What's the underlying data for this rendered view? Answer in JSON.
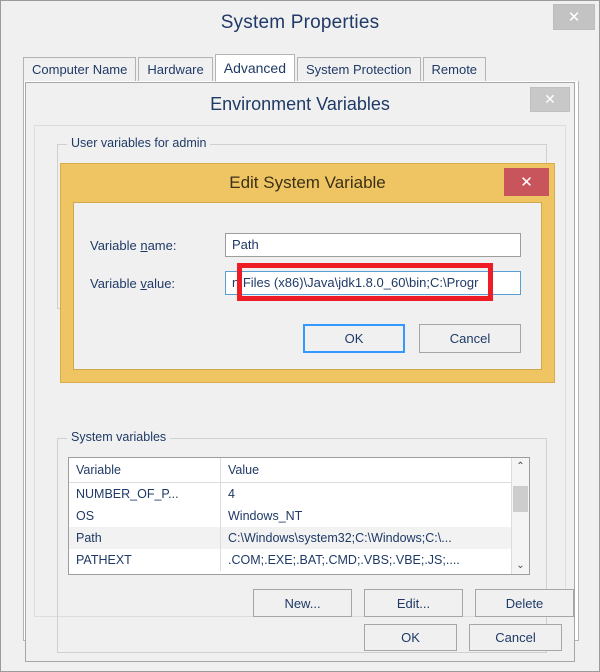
{
  "window": {
    "title": "System Properties",
    "close_label": "✕"
  },
  "tabs": [
    {
      "label": "Computer Name",
      "active": false
    },
    {
      "label": "Hardware",
      "active": false
    },
    {
      "label": "Advanced",
      "active": true
    },
    {
      "label": "System Protection",
      "active": false
    },
    {
      "label": "Remote",
      "active": false
    }
  ],
  "env_dialog": {
    "title": "Environment Variables",
    "close_label": "✕",
    "user_group_legend": "User variables for admin",
    "system_group_legend": "System variables",
    "table": {
      "headers": [
        "Variable",
        "Value"
      ],
      "rows": [
        {
          "variable": "NUMBER_OF_P...",
          "value": "4",
          "selected": false
        },
        {
          "variable": "OS",
          "value": "Windows_NT",
          "selected": false
        },
        {
          "variable": "Path",
          "value": "C:\\Windows\\system32;C:\\Windows;C:\\...",
          "selected": true
        },
        {
          "variable": "PATHEXT",
          "value": ".COM;.EXE;.BAT;.CMD;.VBS;.VBE;.JS;....",
          "selected": false
        }
      ],
      "scroll_up_glyph": "⌃",
      "scroll_down_glyph": "⌄"
    },
    "row_buttons": [
      {
        "label": "New..."
      },
      {
        "label": "Edit..."
      },
      {
        "label": "Delete"
      }
    ],
    "footer_buttons": [
      {
        "label": "OK"
      },
      {
        "label": "Cancel"
      }
    ]
  },
  "edit_dialog": {
    "title": "Edit System Variable",
    "close_label": "✕",
    "titlebar_color": "#EFC564",
    "close_button_color": "#C7555B",
    "highlight_color": "#EE1C25",
    "name_label_pre": "Variable ",
    "name_label_accel": "n",
    "name_label_post": "ame:",
    "name_value": "Path",
    "value_label_pre": "Variable ",
    "value_label_accel": "v",
    "value_label_post": "alue:",
    "value_value": "n Files (x86)\\Java\\jdk1.8.0_60\\bin;C:\\Progr",
    "ok_label": "OK",
    "cancel_label": "Cancel"
  }
}
